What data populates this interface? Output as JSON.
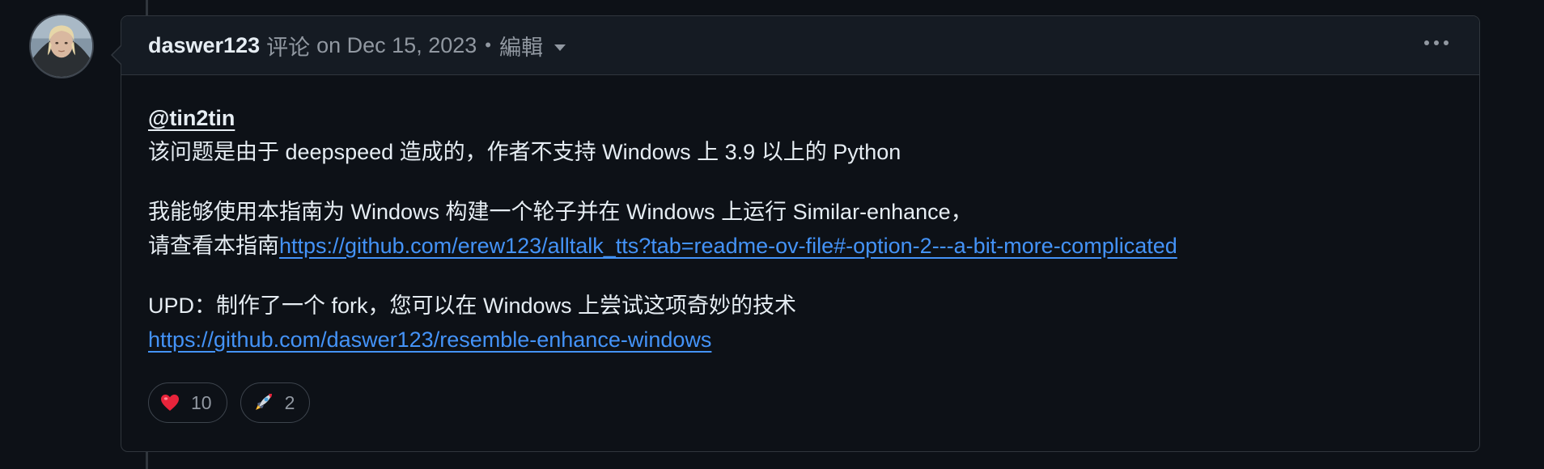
{
  "comment": {
    "author": "daswer123",
    "action": "评论",
    "date": "on Dec 15, 2023",
    "separator": "•",
    "edited_label": "編輯",
    "body": {
      "p1": {
        "mention": "@tin2tin",
        "text": "该问题是由于 deepspeed 造成的，作者不支持 Windows 上 3.9 以上的 Python"
      },
      "p2": {
        "line1": "我能够使用本指南为 Windows 构建一个轮子并在 Windows 上运行 Similar-enhance，",
        "prefix": "请查看本指南",
        "link": "https://github.com/erew123/alltalk_tts?tab=readme-ov-file#-option-2---a-bit-more-complicated"
      },
      "p3": {
        "text": "UPD：制作了一个 fork，您可以在 Windows 上尝试这项奇妙的技术",
        "link": "https://github.com/daswer123/resemble-enhance-windows"
      }
    },
    "reactions": [
      {
        "icon": "heart-icon",
        "count": "10"
      },
      {
        "icon": "rocket-icon",
        "count": "2"
      }
    ]
  },
  "colors": {
    "background": "#0d1117",
    "header_bg": "#151b23",
    "border": "#30363d",
    "link": "#4493f8",
    "muted": "#9198a1",
    "text": "#e6edf3"
  }
}
